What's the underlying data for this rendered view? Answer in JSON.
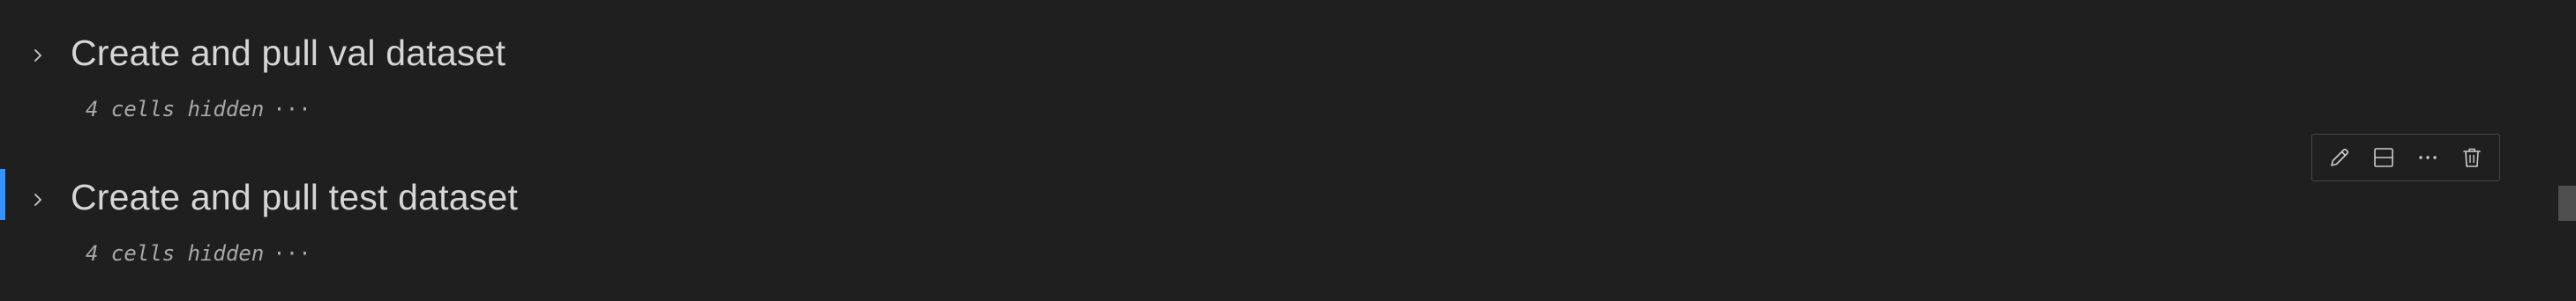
{
  "cells": [
    {
      "heading": "Create and pull val dataset",
      "hidden_label": "4 cells hidden",
      "ellipsis": "···",
      "expand_icon": "chevron-right-icon",
      "focused": false
    },
    {
      "heading": "Create and pull test dataset",
      "hidden_label": "4 cells hidden",
      "ellipsis": "···",
      "expand_icon": "chevron-right-icon",
      "focused": true
    }
  ],
  "cell_toolbar": {
    "buttons": [
      {
        "icon": "pencil-icon",
        "action": "edit"
      },
      {
        "icon": "split-cell-icon",
        "action": "split"
      },
      {
        "icon": "more-icon",
        "action": "more"
      },
      {
        "icon": "trash-icon",
        "action": "delete"
      }
    ]
  },
  "colors": {
    "background": "#1f1f1f",
    "focus_accent": "#3794ff",
    "heading_text": "#d6d6d6",
    "muted_text": "#a8a8a8",
    "toolbar_border": "#474747"
  }
}
